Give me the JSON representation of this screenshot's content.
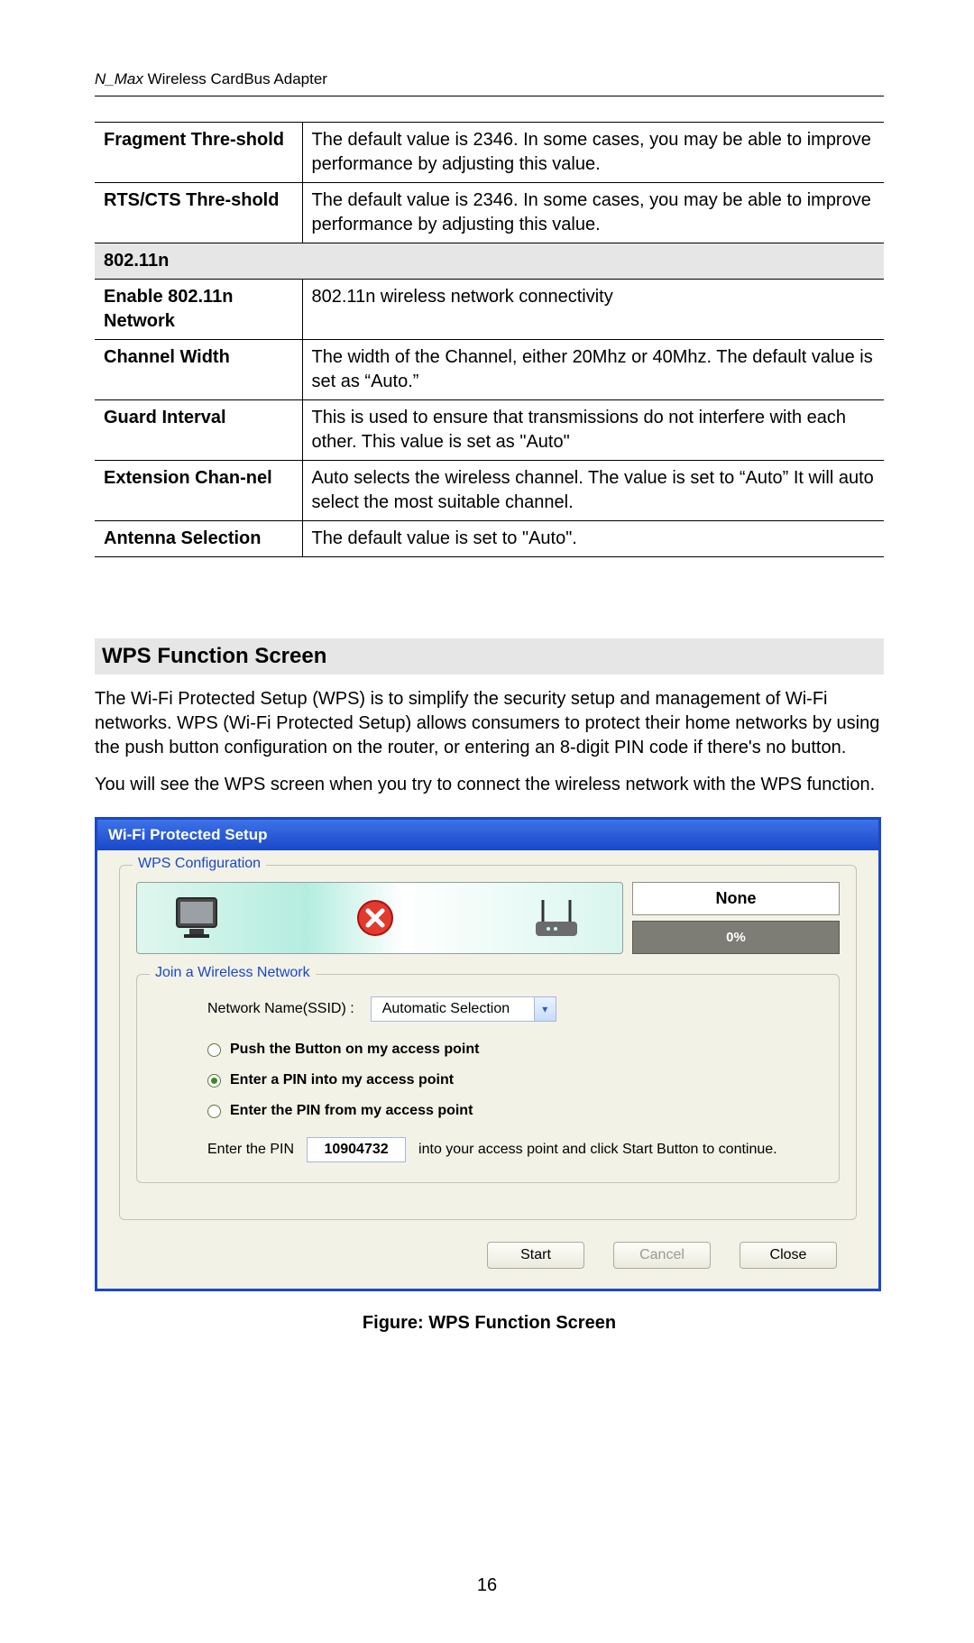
{
  "header": {
    "product_italic": "N_Max",
    "product_rest": " Wireless CardBus Adapter"
  },
  "table": {
    "rows": [
      {
        "label": "Fragment Thre-shold",
        "desc": "The default value is 2346. In some cases, you may be able to improve performance by adjusting this value."
      },
      {
        "label": "RTS/CTS Thre-shold",
        "desc": "The default value is 2346. In some cases, you may be able to improve performance by adjusting this value."
      }
    ],
    "section_label": "802.11n",
    "rows2": [
      {
        "label": "Enable 802.11n Network",
        "desc": "802.11n wireless network connectivity"
      },
      {
        "label": "Channel Width",
        "desc": "The width of the Channel, either 20Mhz or 40Mhz. The default value is set as “Auto.”"
      },
      {
        "label": "Guard Interval",
        "desc": "This is used to ensure that transmissions do not interfere with each other. This value is set as \"Auto\""
      },
      {
        "label": "Extension Chan-nel",
        "desc": "Auto selects the wireless channel. The value is set to “Auto” It will auto select the most suitable channel."
      },
      {
        "label": "Antenna Selection",
        "desc": "The default value is set to \"Auto\"."
      }
    ]
  },
  "section_heading": "WPS Function Screen",
  "paragraph1": "The Wi-Fi Protected Setup (WPS) is to simplify the security setup and management of Wi-Fi networks. WPS (Wi-Fi Protected Setup) allows consumers to protect their home networks by using the push button configuration on the router, or entering an 8-digit PIN code if there's no button.",
  "paragraph2": "You will see the WPS screen when you try to connect the wireless network with the WPS function.",
  "wps": {
    "title": "Wi-Fi Protected Setup",
    "config_legend": "WPS Configuration",
    "status_text": "None",
    "progress_text": "0%",
    "join_legend": "Join a Wireless Network",
    "ssid_label": "Network Name(SSID) :",
    "ssid_value": "Automatic Selection",
    "radio_options": [
      "Push the Button on my access point",
      "Enter a PIN into my access point",
      "Enter the PIN from my access point"
    ],
    "selected_radio_index": 1,
    "pin_label": "Enter the PIN",
    "pin_value": "10904732",
    "pin_suffix": "into your access point and click Start Button to continue.",
    "buttons": {
      "start": "Start",
      "cancel": "Cancel",
      "close": "Close"
    }
  },
  "figure_caption": "Figure: WPS Function Screen",
  "page_number": "16"
}
